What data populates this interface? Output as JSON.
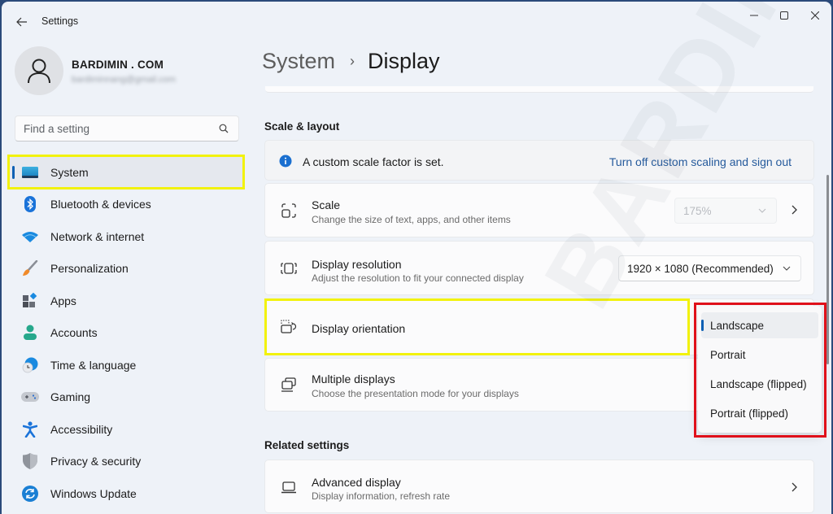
{
  "window": {
    "app_title": "Settings",
    "controls": {
      "minimize": "minimize",
      "maximize": "maximize",
      "close": "close"
    }
  },
  "user": {
    "name": "BARDIMIN . COM",
    "email": "bardiminnang@gmail.com"
  },
  "search": {
    "placeholder": "Find a setting",
    "value": ""
  },
  "sidebar": {
    "items": [
      {
        "label": "System",
        "icon": "system-icon",
        "active": true
      },
      {
        "label": "Bluetooth & devices",
        "icon": "bluetooth-icon"
      },
      {
        "label": "Network & internet",
        "icon": "wifi-icon"
      },
      {
        "label": "Personalization",
        "icon": "brush-icon"
      },
      {
        "label": "Apps",
        "icon": "apps-icon"
      },
      {
        "label": "Accounts",
        "icon": "accounts-icon"
      },
      {
        "label": "Time & language",
        "icon": "time-language-icon"
      },
      {
        "label": "Gaming",
        "icon": "gamepad-icon"
      },
      {
        "label": "Accessibility",
        "icon": "accessibility-icon"
      },
      {
        "label": "Privacy & security",
        "icon": "shield-icon"
      },
      {
        "label": "Windows Update",
        "icon": "update-icon"
      }
    ]
  },
  "breadcrumb": {
    "parent": "System",
    "separator": "›",
    "current": "Display"
  },
  "sections": {
    "scale_layout": "Scale & layout",
    "related": "Related settings"
  },
  "info_bar": {
    "message": "A custom scale factor is set.",
    "link": "Turn off custom scaling and sign out"
  },
  "rows": {
    "scale": {
      "title": "Scale",
      "subtitle": "Change the size of text, apps, and other items",
      "value": "175%",
      "disabled": true
    },
    "resolution": {
      "title": "Display resolution",
      "subtitle": "Adjust the resolution to fit your connected display",
      "value": "1920 × 1080 (Recommended)"
    },
    "orientation": {
      "title": "Display orientation"
    },
    "multiple": {
      "title": "Multiple displays",
      "subtitle": "Choose the presentation mode for your displays"
    },
    "advanced": {
      "title": "Advanced display",
      "subtitle": "Display information, refresh rate"
    }
  },
  "orientation_menu": {
    "options": [
      "Landscape",
      "Portrait",
      "Landscape (flipped)",
      "Portrait (flipped)"
    ],
    "selected": "Landscape"
  },
  "watermark": "BARDIMIN",
  "colors": {
    "accent": "#0a5fb4",
    "link": "#255a9c",
    "highlight_yellow": "#f2f20c",
    "highlight_red": "#e0101a"
  }
}
